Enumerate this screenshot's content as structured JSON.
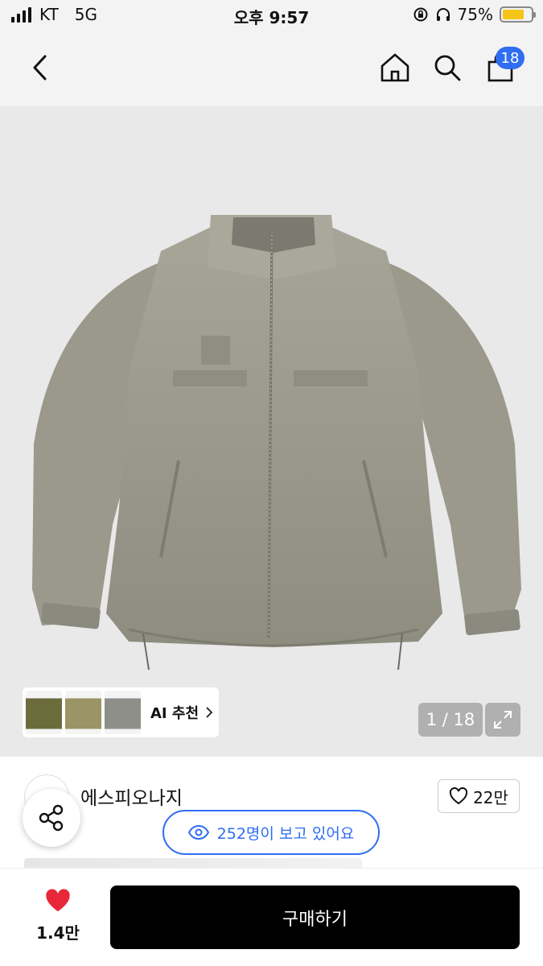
{
  "status_bar": {
    "carrier": "KT",
    "network": "5G",
    "time": "오후 9:57",
    "battery_percent": "75%",
    "battery_level": 0.75
  },
  "nav": {
    "back_icon": "chevron-left-icon",
    "home_icon": "home-icon",
    "search_icon": "search-icon",
    "cart_icon": "shopping-bag-icon",
    "cart_count": "18"
  },
  "gallery": {
    "ai_recommend_label": "AI 추천",
    "counter": "1 / 18",
    "expand_icon": "expand-icon",
    "thumbnail_colors": [
      "#6b6b3c",
      "#9a9466",
      "#8d8f88"
    ]
  },
  "shop": {
    "name": "에스피오나지",
    "like_count": "22만"
  },
  "viewers": {
    "text": "252명이 보고 있어요"
  },
  "bottom": {
    "favorite_count": "1.4만",
    "buy_label": "구매하기"
  },
  "colors": {
    "accent": "#2f6df2",
    "heart": "#e8283a",
    "battery": "#f5c518"
  }
}
